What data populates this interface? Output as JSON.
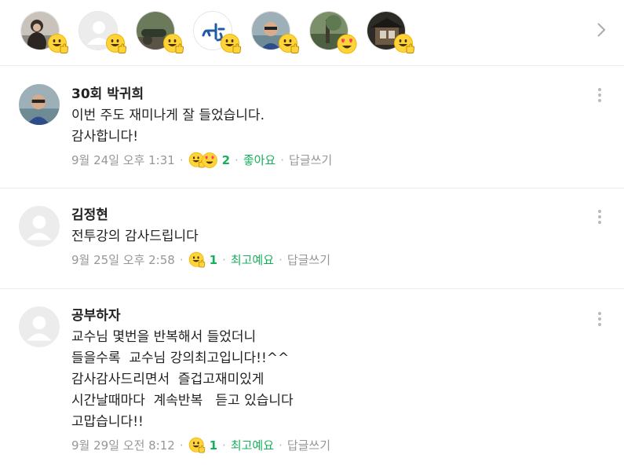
{
  "reactors": [
    {
      "avatar": "woman-photo",
      "reaction": "like-emoji"
    },
    {
      "avatar": "default-avatar",
      "reaction": "like-emoji"
    },
    {
      "avatar": "cannon-photo",
      "reaction": "like-emoji"
    },
    {
      "avatar": "calligraphy-logo",
      "reaction": "like-emoji"
    },
    {
      "avatar": "man-sunglasses-photo",
      "reaction": "like-emoji"
    },
    {
      "avatar": "nature-photo",
      "reaction": "heart-eyes-emoji"
    },
    {
      "avatar": "traditional-house-photo",
      "reaction": "like-emoji"
    }
  ],
  "comments": [
    {
      "author": "30회 박귀희",
      "avatar": "man-sunglasses-photo",
      "lines": [
        "이번 주도 재미나게 잘 들었습니다.",
        "감사합니다!"
      ],
      "date": "9월 24일 오후 1:31",
      "reactions": [
        "like-emoji",
        "heart-eyes-emoji"
      ],
      "count": "2",
      "reaction_label": "좋아요",
      "reply": "답글쓰기"
    },
    {
      "author": "김정현",
      "avatar": "default-avatar",
      "lines": [
        "전투강의 감사드립니다"
      ],
      "date": "9월 25일 오후 2:58",
      "reactions": [
        "like-emoji"
      ],
      "count": "1",
      "reaction_label": "최고예요",
      "reply": "답글쓰기"
    },
    {
      "author": "공부하자",
      "avatar": "default-avatar",
      "lines": [
        "교수님 몇번을 반복해서 들었더니",
        "들을수록  교수님 강의최고입니다!!^^",
        "감사감사드리면서  즐겁고재미있게",
        "시간날때마다  계속반복   듣고 있습니다",
        "고맙습니다!!"
      ],
      "date": "9월 29일 오전 8:12",
      "reactions": [
        "like-emoji"
      ],
      "count": "1",
      "reaction_label": "최고예요",
      "reply": "답글쓰기"
    }
  ],
  "colors": {
    "accent_green": "#16b05c",
    "meta_gray": "#979797",
    "divider": "#ebebeb"
  }
}
